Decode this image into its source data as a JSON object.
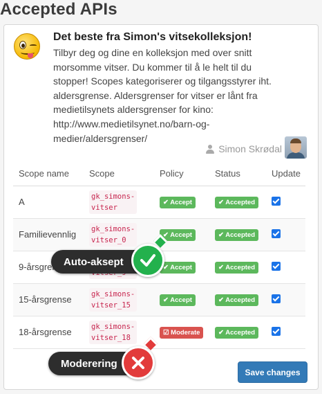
{
  "page": {
    "title": "Accepted APIs"
  },
  "app": {
    "title": "Det beste fra Simon's vitsekolleksjon!",
    "description": "Tilbyr deg og dine en kolleksjon med over snitt\nmorsomme vitser. Du kommer til å le helt til du\nstopper! Scopes kategoriserer og tilgangsstyrer iht.\naldersgrense. Aldersgrenser for vitser er lånt fra\nmedietilsynets aldersgrenser for kino:\nhttp://www.medietilsynet.no/barn-og-\nmedier/aldersgrenser/",
    "author": "Simon Skrødal",
    "icon": "winking-tongue-emoji-icon"
  },
  "table": {
    "headers": [
      "Scope name",
      "Scope",
      "Policy",
      "Status",
      "Update"
    ],
    "rows": [
      {
        "name": "A",
        "scope": "gk_simons-\nvitser",
        "policy": "✔ Accept",
        "policy_type": "accept",
        "status": "✔ Accepted",
        "update": true
      },
      {
        "name": "Familievennlig",
        "scope": "gk_simons-\nvitser_0",
        "policy": "✔ Accept",
        "policy_type": "accept",
        "status": "✔ Accepted",
        "update": true
      },
      {
        "name": "9-årsgrense",
        "scope": "gk_simons-\nvitser_9",
        "policy": "✔ Accept",
        "policy_type": "accept",
        "status": "✔ Accepted",
        "update": true
      },
      {
        "name": "15-årsgrense",
        "scope": "gk_simons-\nvitser_15",
        "policy": "✔ Accept",
        "policy_type": "accept",
        "status": "✔ Accepted",
        "update": true
      },
      {
        "name": "18-årsgrense",
        "scope": "gk_simons-\nvitser_18",
        "policy": "☑ Moderate",
        "policy_type": "moderate",
        "status": "✔ Accepted",
        "update": true
      }
    ]
  },
  "actions": {
    "save_label": "Save changes"
  },
  "annotations": {
    "auto_accept": "Auto-aksept",
    "moderation": "Moderering"
  },
  "colors": {
    "accept": "#5cb85c",
    "moderate": "#d9534f",
    "primary": "#337ab7",
    "callout_ok": "#23b14d",
    "callout_no": "#e23b3b"
  }
}
